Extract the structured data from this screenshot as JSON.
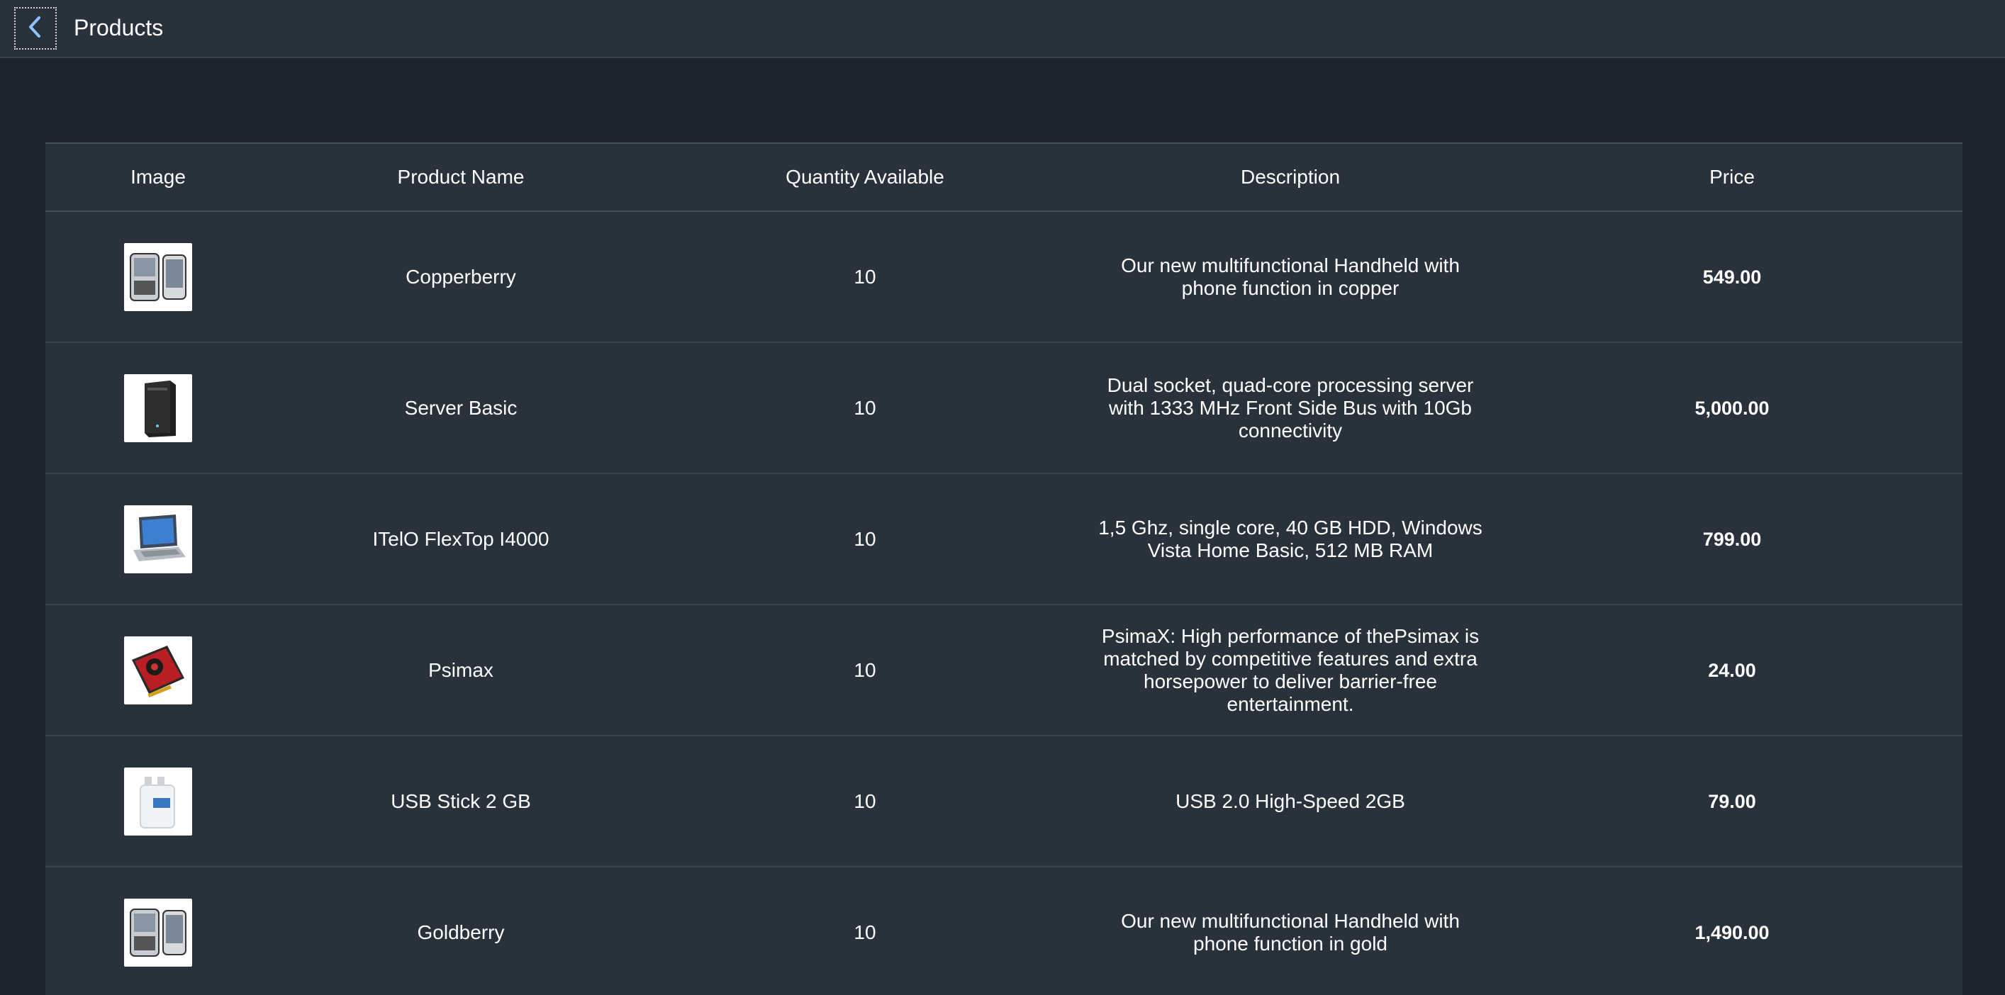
{
  "header": {
    "title": "Products",
    "back_icon": "chevron-left-icon"
  },
  "table": {
    "columns": [
      "Image",
      "Product Name",
      "Quantity Available",
      "Description",
      "Price"
    ],
    "rows": [
      {
        "image": "phone-thumbnail",
        "name": "Copperberry",
        "quantity": "10",
        "description": "Our new multifunctional Handheld with phone function in copper",
        "price": "549.00"
      },
      {
        "image": "server-tower-thumbnail",
        "name": "Server Basic",
        "quantity": "10",
        "description": "Dual socket, quad-core processing server with 1333 MHz Front Side Bus with 10Gb connectivity",
        "price": "5,000.00"
      },
      {
        "image": "laptop-thumbnail",
        "name": "ITelO FlexTop I4000",
        "quantity": "10",
        "description": "1,5 Ghz, single core, 40 GB HDD, Windows Vista Home Basic, 512 MB RAM",
        "price": "799.00"
      },
      {
        "image": "graphics-card-thumbnail",
        "name": "Psimax",
        "quantity": "10",
        "description": "PsimaX: High performance of thePsimax is matched by competitive features and extra horsepower to deliver barrier-free entertainment.",
        "price": "24.00"
      },
      {
        "image": "usb-stick-thumbnail",
        "name": "USB Stick 2 GB",
        "quantity": "10",
        "description": "USB 2.0 High-Speed 2GB",
        "price": "79.00"
      },
      {
        "image": "phone-thumbnail",
        "name": "Goldberry",
        "quantity": "10",
        "description": "Our new multifunctional Handheld with phone function in gold",
        "price": "1,490.00"
      }
    ]
  }
}
